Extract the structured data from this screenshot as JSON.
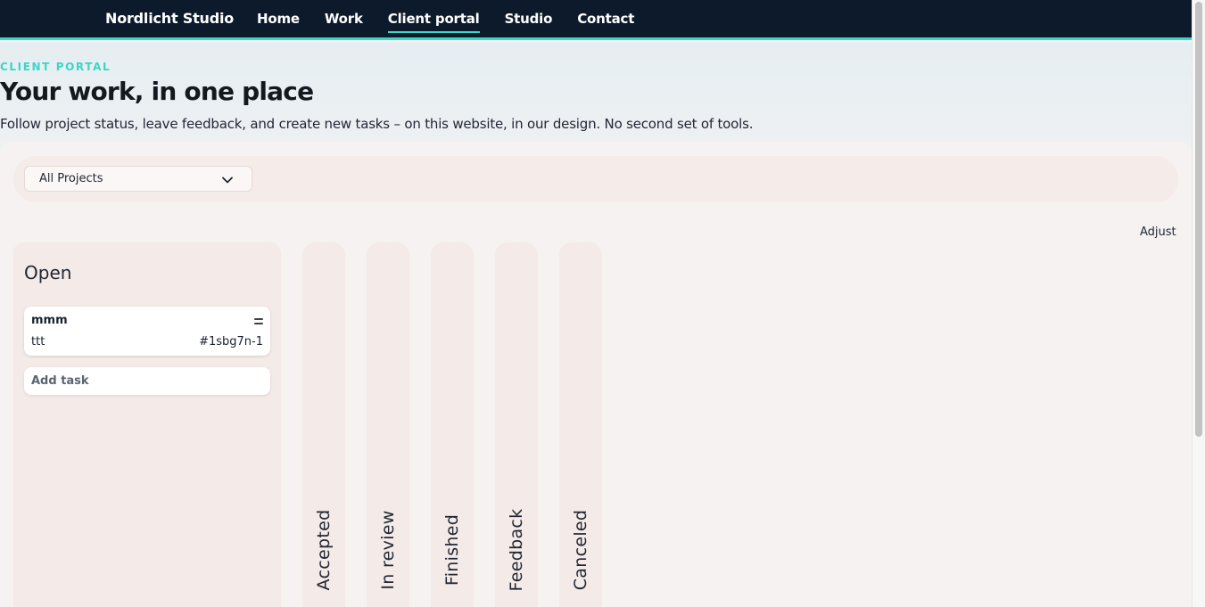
{
  "header": {
    "brand": "Nordlicht Studio",
    "nav": [
      "Home",
      "Work",
      "Client portal",
      "Studio",
      "Contact"
    ],
    "active_nav": "Client portal"
  },
  "hero": {
    "eyebrow": "CLIENT PORTAL",
    "title": "Your work, in one place",
    "subtitle": "Follow project status, leave feedback, and create new tasks – on this website, in our design. No second set of tools."
  },
  "filter": {
    "project_select": "All Projects"
  },
  "board": {
    "adjust_label": "Adjust",
    "open_column": {
      "title": "Open",
      "cards": [
        {
          "title": "mmm",
          "description": "ttt",
          "id": "#1sbg7n-1"
        }
      ],
      "add_task_label": "Add task"
    },
    "collapsed_columns": [
      "Accepted",
      "In review",
      "Finished",
      "Feedback",
      "Canceled"
    ]
  },
  "colors": {
    "header_bg": "#0d1a2b",
    "accent": "#3bd6c6",
    "panel_bg": "#f6f2f1",
    "column_bg": "#f4eae7"
  }
}
